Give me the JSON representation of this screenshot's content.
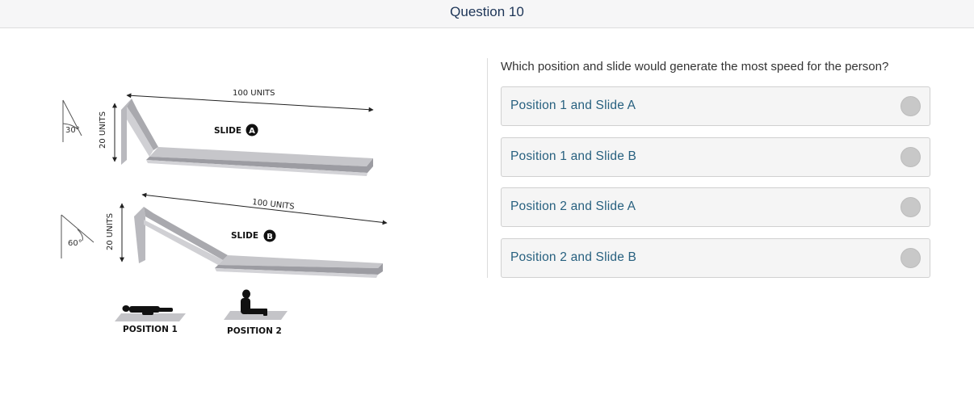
{
  "header": {
    "title": "Question 10"
  },
  "figure": {
    "slide_a": {
      "angle": "30°",
      "height_label": "20 UNITS",
      "length_label": "100 UNITS",
      "slide_word": "SLIDE",
      "slide_letter": "A"
    },
    "slide_b": {
      "angle": "60°",
      "height_label": "20 UNITS",
      "length_label": "100 UNITS",
      "slide_word": "SLIDE",
      "slide_letter": "B"
    },
    "positions": [
      "POSITION 1",
      "POSITION 2"
    ]
  },
  "question": {
    "prompt": "Which position and slide would generate the most speed for the person?",
    "options": [
      {
        "label": "Position 1 and Slide A",
        "selected": false
      },
      {
        "label": "Position 1 and Slide B",
        "selected": false
      },
      {
        "label": "Position 2 and Slide A",
        "selected": false
      },
      {
        "label": "Position 2 and Slide B",
        "selected": false
      }
    ]
  }
}
